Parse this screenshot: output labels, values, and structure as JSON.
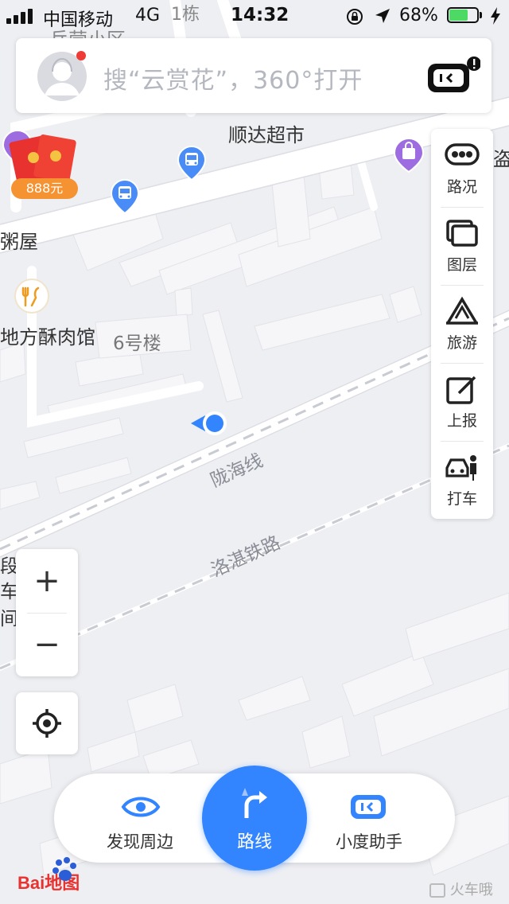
{
  "status_bar": {
    "carrier": "中国移动",
    "network": "4G",
    "time": "14:32",
    "battery": "68%",
    "battery_level": 0.68
  },
  "search": {
    "placeholder": "搜“云赏花”，360°打开"
  },
  "map": {
    "labels": {
      "supermarket": "顺达超市",
      "porridge": "粥屋",
      "restaurant": "地方酥肉馆",
      "building6": "6号楼",
      "railway1": "陇海线",
      "railway2": "洛湛铁路",
      "building1": "1栋",
      "partial_top": "兵营小区",
      "partial_right": "盗",
      "partial_left1": "段",
      "partial_left2": "车间"
    },
    "red_packet": "888元"
  },
  "right_panel": [
    {
      "label": "路况",
      "icon": "traffic-icon"
    },
    {
      "label": "图层",
      "icon": "layers-icon"
    },
    {
      "label": "旅游",
      "icon": "tourism-icon"
    },
    {
      "label": "上报",
      "icon": "report-icon"
    },
    {
      "label": "打车",
      "icon": "taxi-icon"
    }
  ],
  "zoom": {
    "plus": "+",
    "minus": "−"
  },
  "bottom": {
    "discover": "发现周边",
    "route": "路线",
    "assistant": "小度助手"
  },
  "brand": {
    "logo": "Bai地图",
    "watermark": "火车哦"
  },
  "colors": {
    "accent": "#3385ff",
    "battery": "#4cd964",
    "poi_purple": "#9c6ce0",
    "bus_blue": "#4a8cf7",
    "red": "#e8322f"
  }
}
